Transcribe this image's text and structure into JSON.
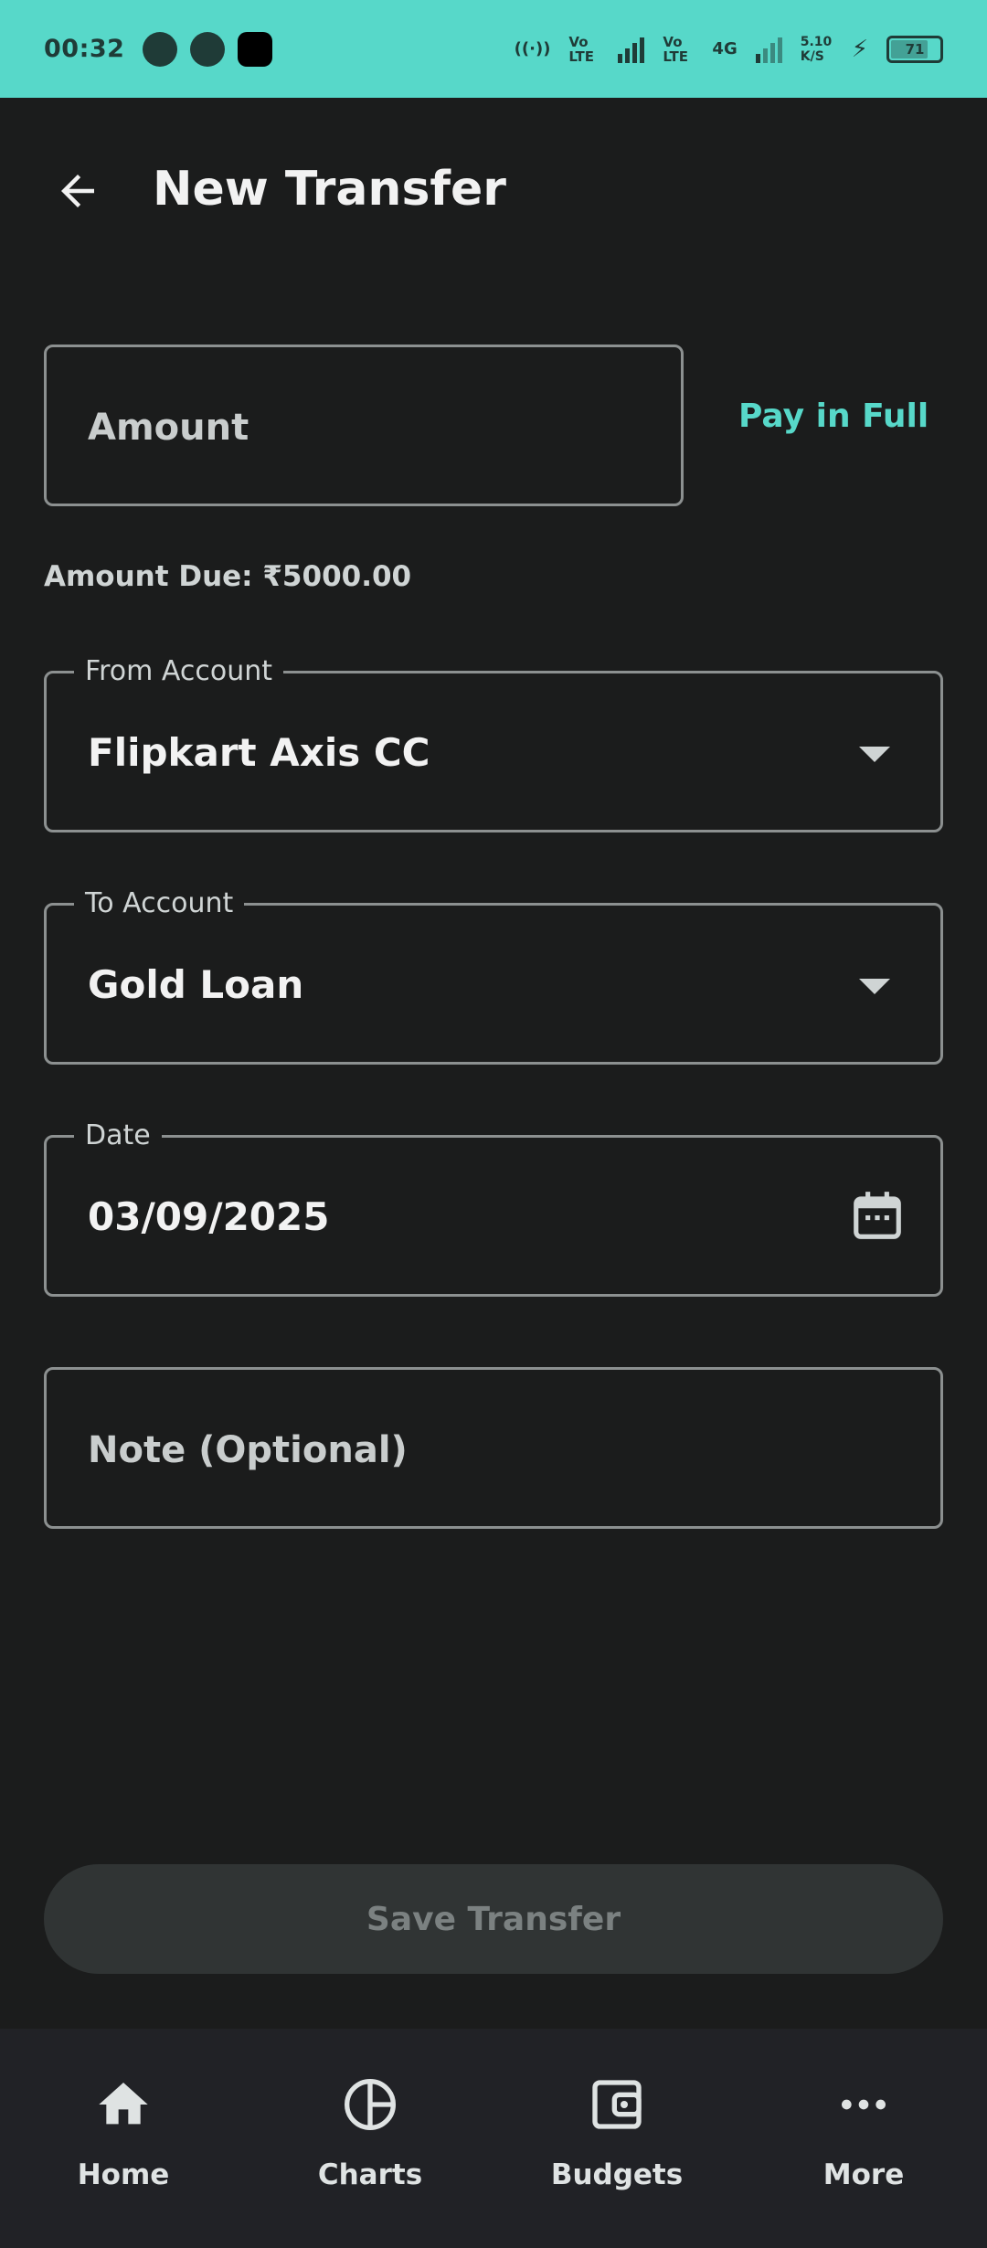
{
  "status_bar": {
    "time": "00:32",
    "net_label_1": "Vo LTE",
    "net_label_2": "Vo LTE",
    "net_label_3": "4G",
    "speed": "5.10 K/S",
    "battery": "71"
  },
  "header": {
    "title": "New Transfer"
  },
  "form": {
    "amount_placeholder": "Amount",
    "pay_in_full_label": "Pay in Full",
    "amount_due": "Amount Due: ₹5000.00",
    "from_account": {
      "label": "From Account",
      "value": "Flipkart Axis CC"
    },
    "to_account": {
      "label": "To Account",
      "value": "Gold Loan"
    },
    "date": {
      "label": "Date",
      "value": "03/09/2025"
    },
    "note_placeholder": "Note (Optional)",
    "save_label": "Save Transfer"
  },
  "bottom_nav": {
    "items": [
      {
        "label": "Home",
        "icon": "home-icon"
      },
      {
        "label": "Charts",
        "icon": "pie-chart-icon"
      },
      {
        "label": "Budgets",
        "icon": "wallet-icon"
      },
      {
        "label": "More",
        "icon": "more-icon"
      }
    ]
  },
  "colors": {
    "accent": "#57d8c9",
    "background": "#1b1c1c",
    "nav_background": "#212226",
    "disabled_button": "#303434"
  }
}
